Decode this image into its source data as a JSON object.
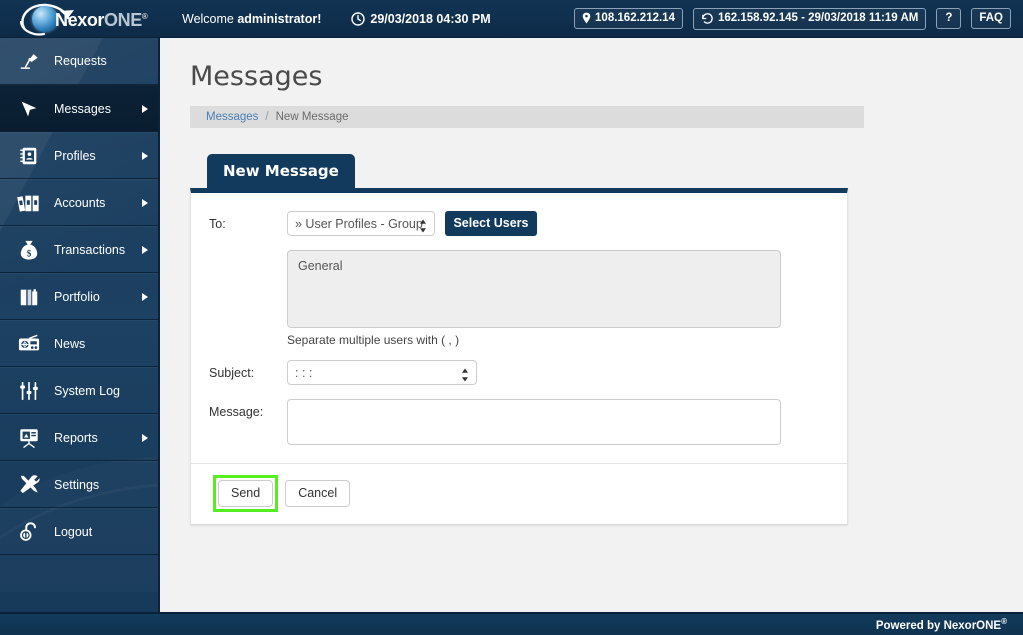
{
  "header": {
    "logo": {
      "name_bold": "Nexor",
      "name_light": "ONE",
      "registered": "®",
      "icon": "nexor-sphere-logo"
    },
    "welcome_prefix": "Welcome ",
    "welcome_user": "administrator!",
    "datetime": "29/03/2018 04:30 PM",
    "datetime_icon": "clock-icon",
    "ip_badge": {
      "icon": "location-pin-icon",
      "text": "108.162.212.14"
    },
    "last_login_badge": {
      "icon": "history-clock-icon",
      "text": "162.158.92.145 - 29/03/2018 11:19 AM"
    },
    "help_button": "?",
    "faq_button": "FAQ"
  },
  "sidebar": {
    "items": [
      {
        "label": "Requests",
        "icon": "desk-lamp-icon",
        "has_arrow": false,
        "active": false
      },
      {
        "label": "Messages",
        "icon": "cursor-arrow-icon",
        "has_arrow": true,
        "active": true
      },
      {
        "label": "Profiles",
        "icon": "address-book-icon",
        "has_arrow": true,
        "active": false
      },
      {
        "label": "Accounts",
        "icon": "binders-icon",
        "has_arrow": true,
        "active": false
      },
      {
        "label": "Transactions",
        "icon": "money-bag-icon",
        "has_arrow": true,
        "active": false
      },
      {
        "label": "Portfolio",
        "icon": "briefcase-icon",
        "has_arrow": true,
        "active": false
      },
      {
        "label": "News",
        "icon": "radio-icon",
        "has_arrow": false,
        "active": false
      },
      {
        "label": "System Log",
        "icon": "sliders-icon",
        "has_arrow": false,
        "active": false
      },
      {
        "label": "Reports",
        "icon": "presentation-icon",
        "has_arrow": true,
        "active": false
      },
      {
        "label": "Settings",
        "icon": "tools-icon",
        "has_arrow": false,
        "active": false
      },
      {
        "label": "Logout",
        "icon": "open-lock-icon",
        "has_arrow": false,
        "active": false
      }
    ]
  },
  "main": {
    "page_title": "Messages",
    "breadcrumb": {
      "root": "Messages",
      "separator": "/",
      "current": "New Message"
    },
    "tab_label": "New Message",
    "form": {
      "to_label": "To:",
      "to_select_value": "» User Profiles - Group",
      "to_select_options": [
        "» User Profiles - Group"
      ],
      "select_users_button": "Select Users",
      "recipients_value": "General",
      "recipients_placeholder": "",
      "hint": "Separate multiple users with ( , )",
      "subject_label": "Subject:",
      "subject_select_value": ": : :",
      "subject_select_options": [
        ": : :"
      ],
      "message_label": "Message:",
      "message_value": "",
      "message_placeholder": ""
    },
    "actions": {
      "send_button": "Send",
      "cancel_button": "Cancel",
      "send_highlight_color": "#55ee22"
    }
  },
  "footer": {
    "text": "Powered by NexorONE",
    "registered": "®"
  },
  "colors": {
    "brand_navy": "#123a5c",
    "sidebar_navy": "#1d4162",
    "content_bg": "#f2f2f2",
    "breadcrumb_bg": "#dcdcdc",
    "link_blue": "#4a7fb5",
    "highlight_green": "#55ee22"
  }
}
